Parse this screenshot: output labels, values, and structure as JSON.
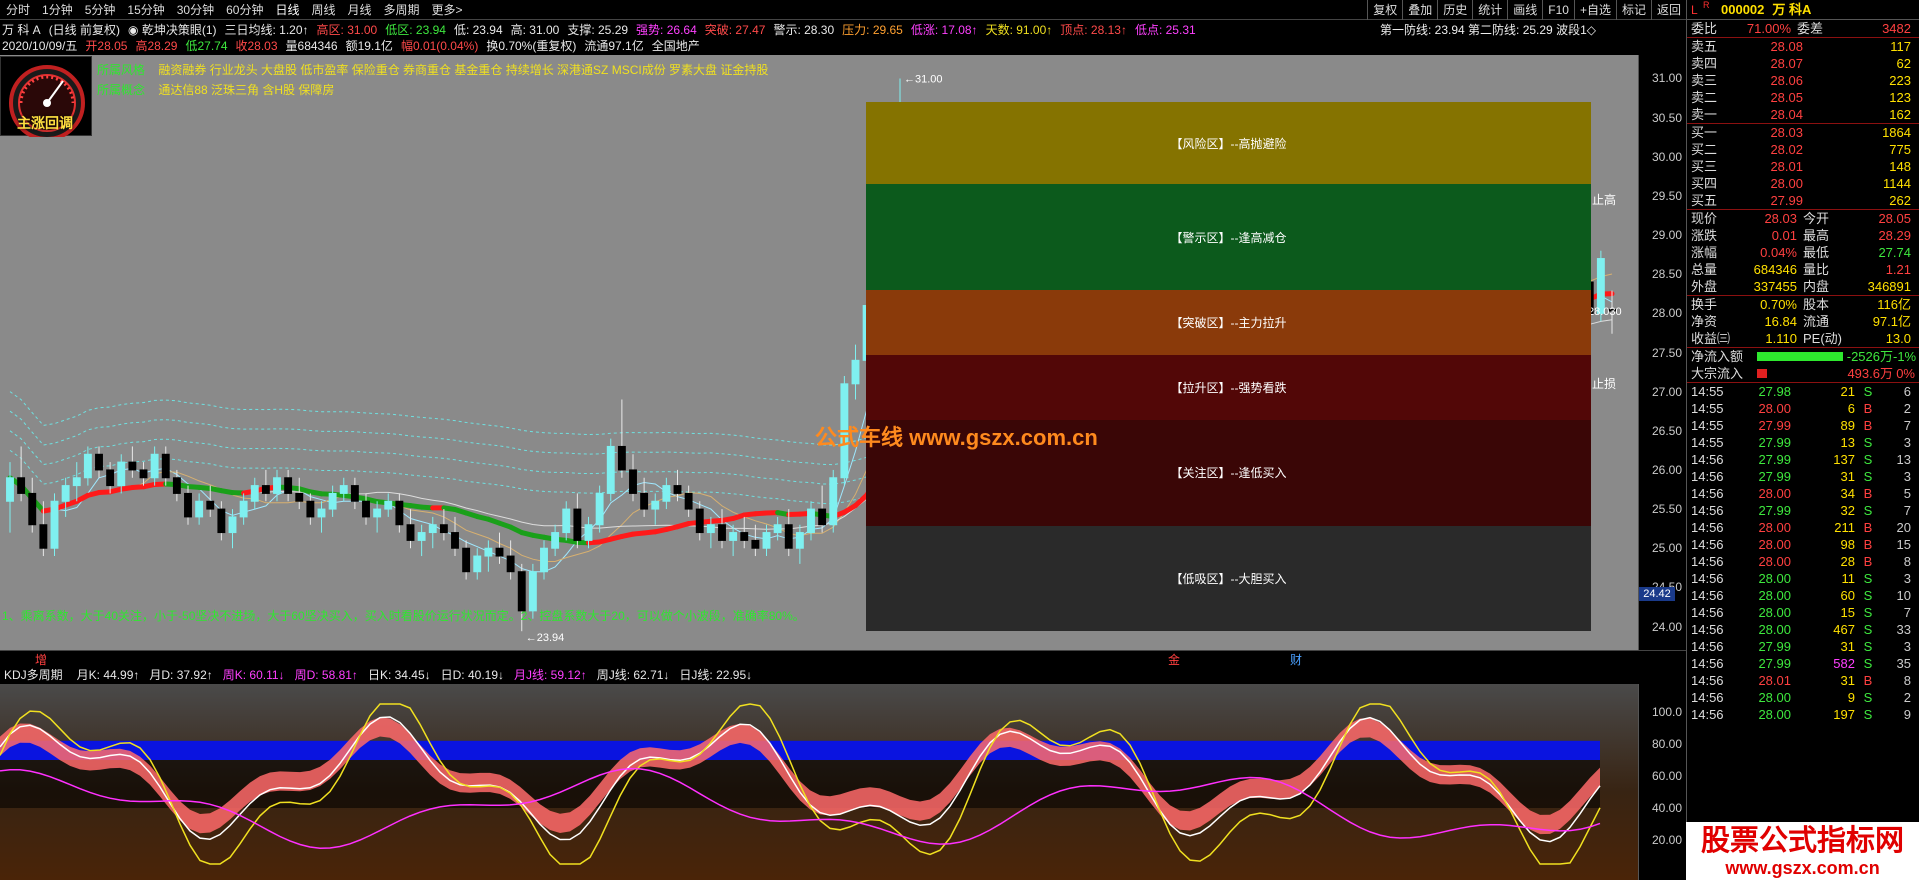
{
  "toolbar": {
    "timeframes": [
      "分时",
      "1分钟",
      "5分钟",
      "15分钟",
      "30分钟",
      "60分钟",
      "日线",
      "周线",
      "月线",
      "多周期",
      "更多>"
    ],
    "right_buttons": [
      "复权",
      "叠加",
      "历史",
      "统计",
      "画线",
      "F10",
      "+自选",
      "标记",
      "返回"
    ]
  },
  "header": {
    "line1": [
      {
        "t": "万 科 A",
        "c": "w"
      },
      {
        "t": "(日线 前复权)",
        "c": "w"
      },
      {
        "t": "◉ 乾坤决策眼(1)",
        "c": "w"
      },
      {
        "t": "三日均线: 1.20↑",
        "c": "w"
      },
      {
        "t": "高区: 31.00",
        "c": "r"
      },
      {
        "t": "低区: 23.94",
        "c": "g"
      },
      {
        "t": "低: 23.94",
        "c": "w"
      },
      {
        "t": "高: 31.00",
        "c": "w"
      },
      {
        "t": "支撑: 25.29",
        "c": "w"
      },
      {
        "t": "强势: 26.64",
        "c": "m"
      },
      {
        "t": "突破: 27.47",
        "c": "r"
      },
      {
        "t": "警示: 28.30",
        "c": "w"
      },
      {
        "t": "压力: 29.65",
        "c": "o"
      },
      {
        "t": "低涨: 17.08↑",
        "c": "m"
      },
      {
        "t": "天数: 91.00↑",
        "c": "y"
      },
      {
        "t": "顶点: 28.13↑",
        "c": "r"
      },
      {
        "t": "低点: 25.31",
        "c": "m"
      }
    ],
    "line2": [
      {
        "t": "2020/10/09/五",
        "c": "w"
      },
      {
        "t": "开28.05",
        "c": "r"
      },
      {
        "t": "高28.29",
        "c": "r"
      },
      {
        "t": "低27.74",
        "c": "g"
      },
      {
        "t": "收28.03",
        "c": "r"
      },
      {
        "t": "量684346",
        "c": "w"
      },
      {
        "t": "额19.1亿",
        "c": "w"
      },
      {
        "t": "幅0.01(0.04%)",
        "c": "r"
      },
      {
        "t": "换0.70%(重复权)",
        "c": "w"
      },
      {
        "t": "流通97.1亿",
        "c": "w"
      },
      {
        "t": "全国地产",
        "c": "w"
      }
    ],
    "defense": "第一防线: 23.94  第二防线: 25.29  波段1◇"
  },
  "gauge_label": "主涨回调",
  "industry": {
    "style_label": "所属风格",
    "style_text": "融资融券 行业龙头 大盘股 低市盈率 保险重仓 券商重仓 基金重仓 持续增长 深港通SZ MSCI成份 罗素大盘 证金持股",
    "concept_label": "所属概念",
    "concept_text": "通达信88 泛珠三角 含H股 保障房"
  },
  "zones": [
    {
      "name": "【风险区】--高抛避险",
      "color": "#857300"
    },
    {
      "name": "【警示区】--逢高减仓",
      "color": "#0c5a1c"
    },
    {
      "name": "【突破区】--主力拉升",
      "color": "#8a3a0a"
    },
    {
      "name": "【拉升区】--强势看跌",
      "color": "#520707"
    },
    {
      "name": "【关注区】--逢低买入",
      "color": "#3a0606"
    },
    {
      "name": "【低吸区】--大胆买入",
      "color": "#2a2a2a"
    }
  ],
  "markers": {
    "high": "31.00",
    "low": "23.94",
    "stop_high": "止高",
    "stop_loss": "止损",
    "last": "28.030",
    "axis_badge": "24.42"
  },
  "watermark": "公式车线  www.gszx.com.cn",
  "note": "1、乘离系数，大于40关注，小于-50坚决不进场，大于60坚决买入，买入时看股价运行状况而定。2、控盘系数大于20，可以做个小波段，准确率80%。",
  "price_axis": [
    "31.00",
    "30.50",
    "30.00",
    "29.50",
    "29.00",
    "28.50",
    "28.00",
    "27.50",
    "27.00",
    "26.50",
    "26.00",
    "25.50",
    "25.00",
    "24.50",
    "24.00"
  ],
  "midbar": {
    "left": "增",
    "m1": "金",
    "m2": "财"
  },
  "kdj": {
    "name": "KDJ多周期",
    "items": [
      {
        "t": "月K: 44.99↑",
        "c": "w"
      },
      {
        "t": "月D: 37.92↑",
        "c": "w"
      },
      {
        "t": "周K: 60.11↓",
        "c": "m"
      },
      {
        "t": "周D: 58.81↑",
        "c": "m"
      },
      {
        "t": "日K: 34.45↓",
        "c": "w"
      },
      {
        "t": "日D: 40.19↓",
        "c": "w"
      },
      {
        "t": "月J线: 59.12↑",
        "c": "m"
      },
      {
        "t": "周J线: 62.71↓",
        "c": "w"
      },
      {
        "t": "日J线: 22.95↓",
        "c": "w"
      }
    ],
    "axis": [
      "100.0",
      "80.00",
      "60.00",
      "40.00",
      "20.00"
    ]
  },
  "quote": {
    "code": "000002",
    "name": "万 科A",
    "ratio_label": "委比",
    "ratio": "71.00%",
    "diff_label": "委差",
    "diff": "3482",
    "asks": [
      {
        "l": "卖五",
        "p": "28.08",
        "v": "117"
      },
      {
        "l": "卖四",
        "p": "28.07",
        "v": "62"
      },
      {
        "l": "卖三",
        "p": "28.06",
        "v": "223"
      },
      {
        "l": "卖二",
        "p": "28.05",
        "v": "123"
      },
      {
        "l": "卖一",
        "p": "28.04",
        "v": "162"
      }
    ],
    "bids": [
      {
        "l": "买一",
        "p": "28.03",
        "v": "1864"
      },
      {
        "l": "买二",
        "p": "28.02",
        "v": "775"
      },
      {
        "l": "买三",
        "p": "28.01",
        "v": "148"
      },
      {
        "l": "买四",
        "p": "28.00",
        "v": "1144"
      },
      {
        "l": "买五",
        "p": "27.99",
        "v": "262"
      }
    ],
    "stats": [
      [
        "现价",
        "28.03",
        "今开",
        "28.05"
      ],
      [
        "涨跌",
        "0.01",
        "最高",
        "28.29"
      ],
      [
        "涨幅",
        "0.04%",
        "最低",
        "27.74"
      ],
      [
        "总量",
        "684346",
        "量比",
        "1.21"
      ],
      [
        "外盘",
        "337455",
        "内盘",
        "346891"
      ]
    ],
    "stats2": [
      [
        "换手",
        "0.70%",
        "股本",
        "116亿"
      ],
      [
        "净资",
        "16.84",
        "流通",
        "97.1亿"
      ],
      [
        "收益㈢",
        "1.110",
        "PE(动)",
        "13.0"
      ]
    ],
    "flow": [
      {
        "l": "净流入额",
        "v": "-2526万",
        "p": "-1%",
        "bar": "#2ee82e"
      },
      {
        "l": "大宗流入",
        "v": "493.6万",
        "p": "0%",
        "bar": "#e02020"
      }
    ],
    "ticks": [
      [
        "14:55",
        "27.98",
        "21",
        "S",
        "6"
      ],
      [
        "14:55",
        "28.00",
        "6",
        "B",
        "2"
      ],
      [
        "14:55",
        "27.99",
        "89",
        "B",
        "7"
      ],
      [
        "14:55",
        "27.99",
        "13",
        "S",
        "3"
      ],
      [
        "14:56",
        "27.99",
        "137",
        "S",
        "13"
      ],
      [
        "14:56",
        "27.99",
        "31",
        "S",
        "3"
      ],
      [
        "14:56",
        "28.00",
        "34",
        "B",
        "5"
      ],
      [
        "14:56",
        "27.99",
        "32",
        "S",
        "7"
      ],
      [
        "14:56",
        "28.00",
        "211",
        "B",
        "20"
      ],
      [
        "14:56",
        "28.00",
        "98",
        "B",
        "15"
      ],
      [
        "14:56",
        "28.00",
        "28",
        "B",
        "8"
      ],
      [
        "14:56",
        "28.00",
        "11",
        "S",
        "3"
      ],
      [
        "14:56",
        "28.00",
        "60",
        "S",
        "10"
      ],
      [
        "14:56",
        "28.00",
        "15",
        "S",
        "7"
      ],
      [
        "14:56",
        "28.00",
        "467",
        "S",
        "33"
      ],
      [
        "14:56",
        "27.99",
        "31",
        "S",
        "3"
      ],
      [
        "14:56",
        "27.99",
        "582",
        "S",
        "35"
      ],
      [
        "14:56",
        "28.01",
        "31",
        "B",
        "8"
      ],
      [
        "14:56",
        "28.00",
        "9",
        "S",
        "2"
      ],
      [
        "14:56",
        "28.00",
        "197",
        "S",
        "9"
      ]
    ]
  },
  "logo": {
    "line1": "股票公式指标网",
    "line2": "www.gszx.com.cn"
  },
  "chart_data": {
    "type": "candlestick",
    "ylim": [
      23.7,
      31.3
    ],
    "ohlc": [
      [
        25.6,
        26.1,
        25.2,
        25.9
      ],
      [
        25.9,
        26.3,
        25.6,
        25.7
      ],
      [
        25.7,
        25.9,
        25.2,
        25.3
      ],
      [
        25.3,
        25.6,
        24.9,
        25.0
      ],
      [
        25.0,
        25.7,
        24.9,
        25.6
      ],
      [
        25.6,
        25.9,
        25.4,
        25.8
      ],
      [
        25.8,
        26.1,
        25.6,
        25.9
      ],
      [
        25.9,
        26.3,
        25.8,
        26.2
      ],
      [
        26.2,
        26.3,
        25.9,
        26.0
      ],
      [
        26.0,
        26.1,
        25.7,
        25.8
      ],
      [
        25.8,
        26.2,
        25.7,
        26.1
      ],
      [
        26.1,
        26.3,
        25.9,
        26.0
      ],
      [
        26.0,
        26.1,
        25.8,
        25.9
      ],
      [
        25.9,
        26.3,
        25.8,
        26.2
      ],
      [
        26.2,
        26.3,
        25.8,
        25.9
      ],
      [
        25.9,
        26.0,
        25.6,
        25.7
      ],
      [
        25.7,
        25.8,
        25.3,
        25.4
      ],
      [
        25.4,
        25.7,
        25.3,
        25.6
      ],
      [
        25.6,
        25.8,
        25.4,
        25.5
      ],
      [
        25.5,
        25.6,
        25.1,
        25.2
      ],
      [
        25.2,
        25.5,
        25.0,
        25.4
      ],
      [
        25.4,
        25.7,
        25.3,
        25.6
      ],
      [
        25.6,
        25.9,
        25.5,
        25.8
      ],
      [
        25.8,
        26.0,
        25.6,
        25.7
      ],
      [
        25.7,
        26.0,
        25.6,
        25.9
      ],
      [
        25.9,
        26.0,
        25.6,
        25.7
      ],
      [
        25.7,
        25.9,
        25.5,
        25.6
      ],
      [
        25.6,
        25.7,
        25.3,
        25.4
      ],
      [
        25.4,
        25.6,
        25.2,
        25.5
      ],
      [
        25.5,
        25.8,
        25.4,
        25.7
      ],
      [
        25.7,
        25.9,
        25.6,
        25.8
      ],
      [
        25.8,
        25.9,
        25.5,
        25.6
      ],
      [
        25.6,
        25.7,
        25.3,
        25.4
      ],
      [
        25.4,
        25.6,
        25.2,
        25.5
      ],
      [
        25.5,
        25.7,
        25.4,
        25.6
      ],
      [
        25.6,
        25.7,
        25.2,
        25.3
      ],
      [
        25.3,
        25.5,
        25.0,
        25.1
      ],
      [
        25.1,
        25.3,
        24.9,
        25.2
      ],
      [
        25.2,
        25.4,
        25.0,
        25.3
      ],
      [
        25.3,
        25.5,
        25.1,
        25.2
      ],
      [
        25.2,
        25.4,
        24.9,
        25.0
      ],
      [
        25.0,
        25.1,
        24.6,
        24.7
      ],
      [
        24.7,
        25.0,
        24.6,
        24.9
      ],
      [
        24.9,
        25.1,
        24.7,
        25.0
      ],
      [
        25.0,
        25.2,
        24.8,
        24.9
      ],
      [
        24.9,
        25.1,
        24.6,
        24.7
      ],
      [
        24.7,
        24.8,
        23.94,
        24.2
      ],
      [
        24.2,
        24.8,
        24.1,
        24.7
      ],
      [
        24.7,
        25.1,
        24.6,
        25.0
      ],
      [
        25.0,
        25.3,
        24.9,
        25.2
      ],
      [
        25.2,
        25.6,
        25.1,
        25.5
      ],
      [
        25.5,
        25.7,
        25.0,
        25.1
      ],
      [
        25.1,
        25.4,
        25.0,
        25.3
      ],
      [
        25.3,
        25.8,
        25.2,
        25.7
      ],
      [
        25.7,
        26.4,
        25.6,
        26.3
      ],
      [
        26.3,
        26.9,
        25.9,
        26.0
      ],
      [
        26.0,
        26.2,
        25.6,
        25.7
      ],
      [
        25.7,
        25.9,
        25.4,
        25.5
      ],
      [
        25.5,
        25.7,
        25.3,
        25.6
      ],
      [
        25.6,
        25.9,
        25.5,
        25.8
      ],
      [
        25.8,
        26.0,
        25.6,
        25.7
      ],
      [
        25.7,
        25.8,
        25.4,
        25.5
      ],
      [
        25.5,
        25.6,
        25.1,
        25.2
      ],
      [
        25.2,
        25.4,
        25.0,
        25.3
      ],
      [
        25.3,
        25.5,
        25.0,
        25.1
      ],
      [
        25.1,
        25.3,
        24.9,
        25.2
      ],
      [
        25.2,
        25.4,
        25.0,
        25.1
      ],
      [
        25.1,
        25.3,
        24.9,
        25.0
      ],
      [
        25.0,
        25.3,
        24.9,
        25.2
      ],
      [
        25.2,
        25.4,
        25.1,
        25.3
      ],
      [
        25.3,
        25.5,
        24.9,
        25.0
      ],
      [
        25.0,
        25.3,
        24.8,
        25.2
      ],
      [
        25.2,
        25.6,
        25.1,
        25.5
      ],
      [
        25.5,
        25.8,
        25.2,
        25.3
      ],
      [
        25.3,
        26.0,
        25.2,
        25.9
      ],
      [
        25.9,
        27.2,
        25.8,
        27.1
      ],
      [
        27.1,
        27.6,
        26.9,
        27.4
      ],
      [
        27.4,
        28.2,
        27.3,
        28.1
      ],
      [
        28.1,
        30.1,
        28.0,
        30.0
      ],
      [
        30.0,
        30.5,
        29.2,
        29.3
      ],
      [
        29.3,
        31.0,
        29.0,
        30.5
      ],
      [
        30.5,
        30.6,
        29.1,
        29.2
      ],
      [
        29.2,
        29.8,
        28.8,
        29.5
      ],
      [
        29.5,
        29.7,
        28.0,
        28.3
      ],
      [
        28.3,
        29.1,
        28.1,
        28.9
      ],
      [
        28.9,
        29.0,
        27.8,
        27.9
      ],
      [
        27.9,
        28.4,
        27.6,
        28.2
      ],
      [
        28.2,
        28.3,
        27.2,
        27.3
      ],
      [
        27.3,
        27.7,
        26.7,
        26.8
      ],
      [
        26.8,
        27.1,
        26.3,
        26.4
      ],
      [
        26.4,
        26.9,
        26.0,
        26.8
      ],
      [
        26.8,
        27.3,
        26.5,
        26.6
      ],
      [
        26.6,
        27.1,
        26.4,
        27.0
      ],
      [
        27.0,
        27.4,
        26.6,
        26.7
      ],
      [
        26.7,
        26.9,
        26.2,
        26.3
      ],
      [
        26.3,
        26.5,
        25.7,
        25.8
      ],
      [
        25.8,
        26.1,
        25.3,
        25.9
      ],
      [
        25.9,
        26.2,
        25.6,
        25.7
      ],
      [
        25.7,
        26.0,
        25.5,
        25.8
      ],
      [
        25.8,
        26.4,
        25.7,
        26.3
      ],
      [
        26.3,
        26.5,
        26.0,
        26.1
      ],
      [
        26.1,
        26.3,
        25.8,
        25.9
      ],
      [
        25.9,
        26.5,
        25.8,
        26.4
      ],
      [
        26.4,
        26.7,
        26.2,
        26.3
      ],
      [
        26.3,
        26.6,
        26.0,
        26.5
      ],
      [
        26.5,
        26.9,
        26.4,
        26.6
      ],
      [
        26.6,
        26.7,
        26.1,
        26.2
      ],
      [
        26.2,
        26.5,
        26.0,
        26.4
      ],
      [
        26.4,
        26.8,
        26.3,
        26.7
      ],
      [
        26.7,
        27.2,
        26.6,
        27.1
      ],
      [
        27.1,
        27.7,
        27.0,
        27.6
      ],
      [
        27.6,
        27.9,
        27.2,
        27.3
      ],
      [
        27.3,
        28.6,
        27.2,
        28.2
      ],
      [
        28.2,
        28.4,
        27.5,
        27.6
      ],
      [
        27.6,
        27.9,
        27.3,
        27.4
      ],
      [
        27.4,
        27.8,
        27.2,
        27.7
      ],
      [
        27.7,
        27.9,
        27.2,
        27.3
      ],
      [
        27.3,
        27.6,
        26.9,
        27.0
      ],
      [
        27.0,
        27.4,
        26.8,
        27.3
      ],
      [
        27.3,
        27.6,
        26.5,
        26.6
      ],
      [
        26.6,
        27.2,
        26.5,
        27.1
      ],
      [
        27.1,
        27.4,
        26.8,
        26.9
      ],
      [
        26.9,
        27.3,
        26.7,
        27.2
      ],
      [
        27.2,
        27.6,
        27.0,
        27.5
      ],
      [
        27.5,
        28.0,
        27.3,
        27.9
      ],
      [
        27.9,
        28.3,
        27.7,
        27.8
      ],
      [
        27.8,
        28.6,
        27.7,
        28.5
      ],
      [
        28.5,
        28.7,
        28.0,
        28.1
      ],
      [
        28.1,
        28.4,
        27.7,
        27.8
      ],
      [
        27.8,
        28.3,
        27.6,
        28.2
      ],
      [
        28.2,
        28.4,
        27.8,
        27.9
      ],
      [
        27.9,
        28.3,
        27.5,
        27.6
      ],
      [
        27.6,
        28.4,
        27.5,
        28.3
      ],
      [
        28.3,
        29.1,
        28.2,
        28.1
      ],
      [
        28.1,
        28.2,
        27.6,
        27.7
      ],
      [
        27.7,
        28.6,
        27.6,
        28.5
      ],
      [
        28.5,
        29.5,
        28.4,
        29.4
      ],
      [
        29.4,
        29.6,
        29.0,
        29.2
      ],
      [
        29.2,
        29.3,
        28.7,
        28.8
      ],
      [
        28.8,
        29.2,
        28.3,
        28.4
      ],
      [
        28.4,
        28.6,
        27.4,
        27.6
      ],
      [
        27.6,
        28.5,
        27.5,
        28.4
      ],
      [
        28.4,
        28.5,
        27.9,
        28.0
      ],
      [
        28.0,
        28.8,
        27.9,
        28.7
      ],
      [
        28.05,
        28.29,
        27.74,
        28.03
      ]
    ]
  }
}
